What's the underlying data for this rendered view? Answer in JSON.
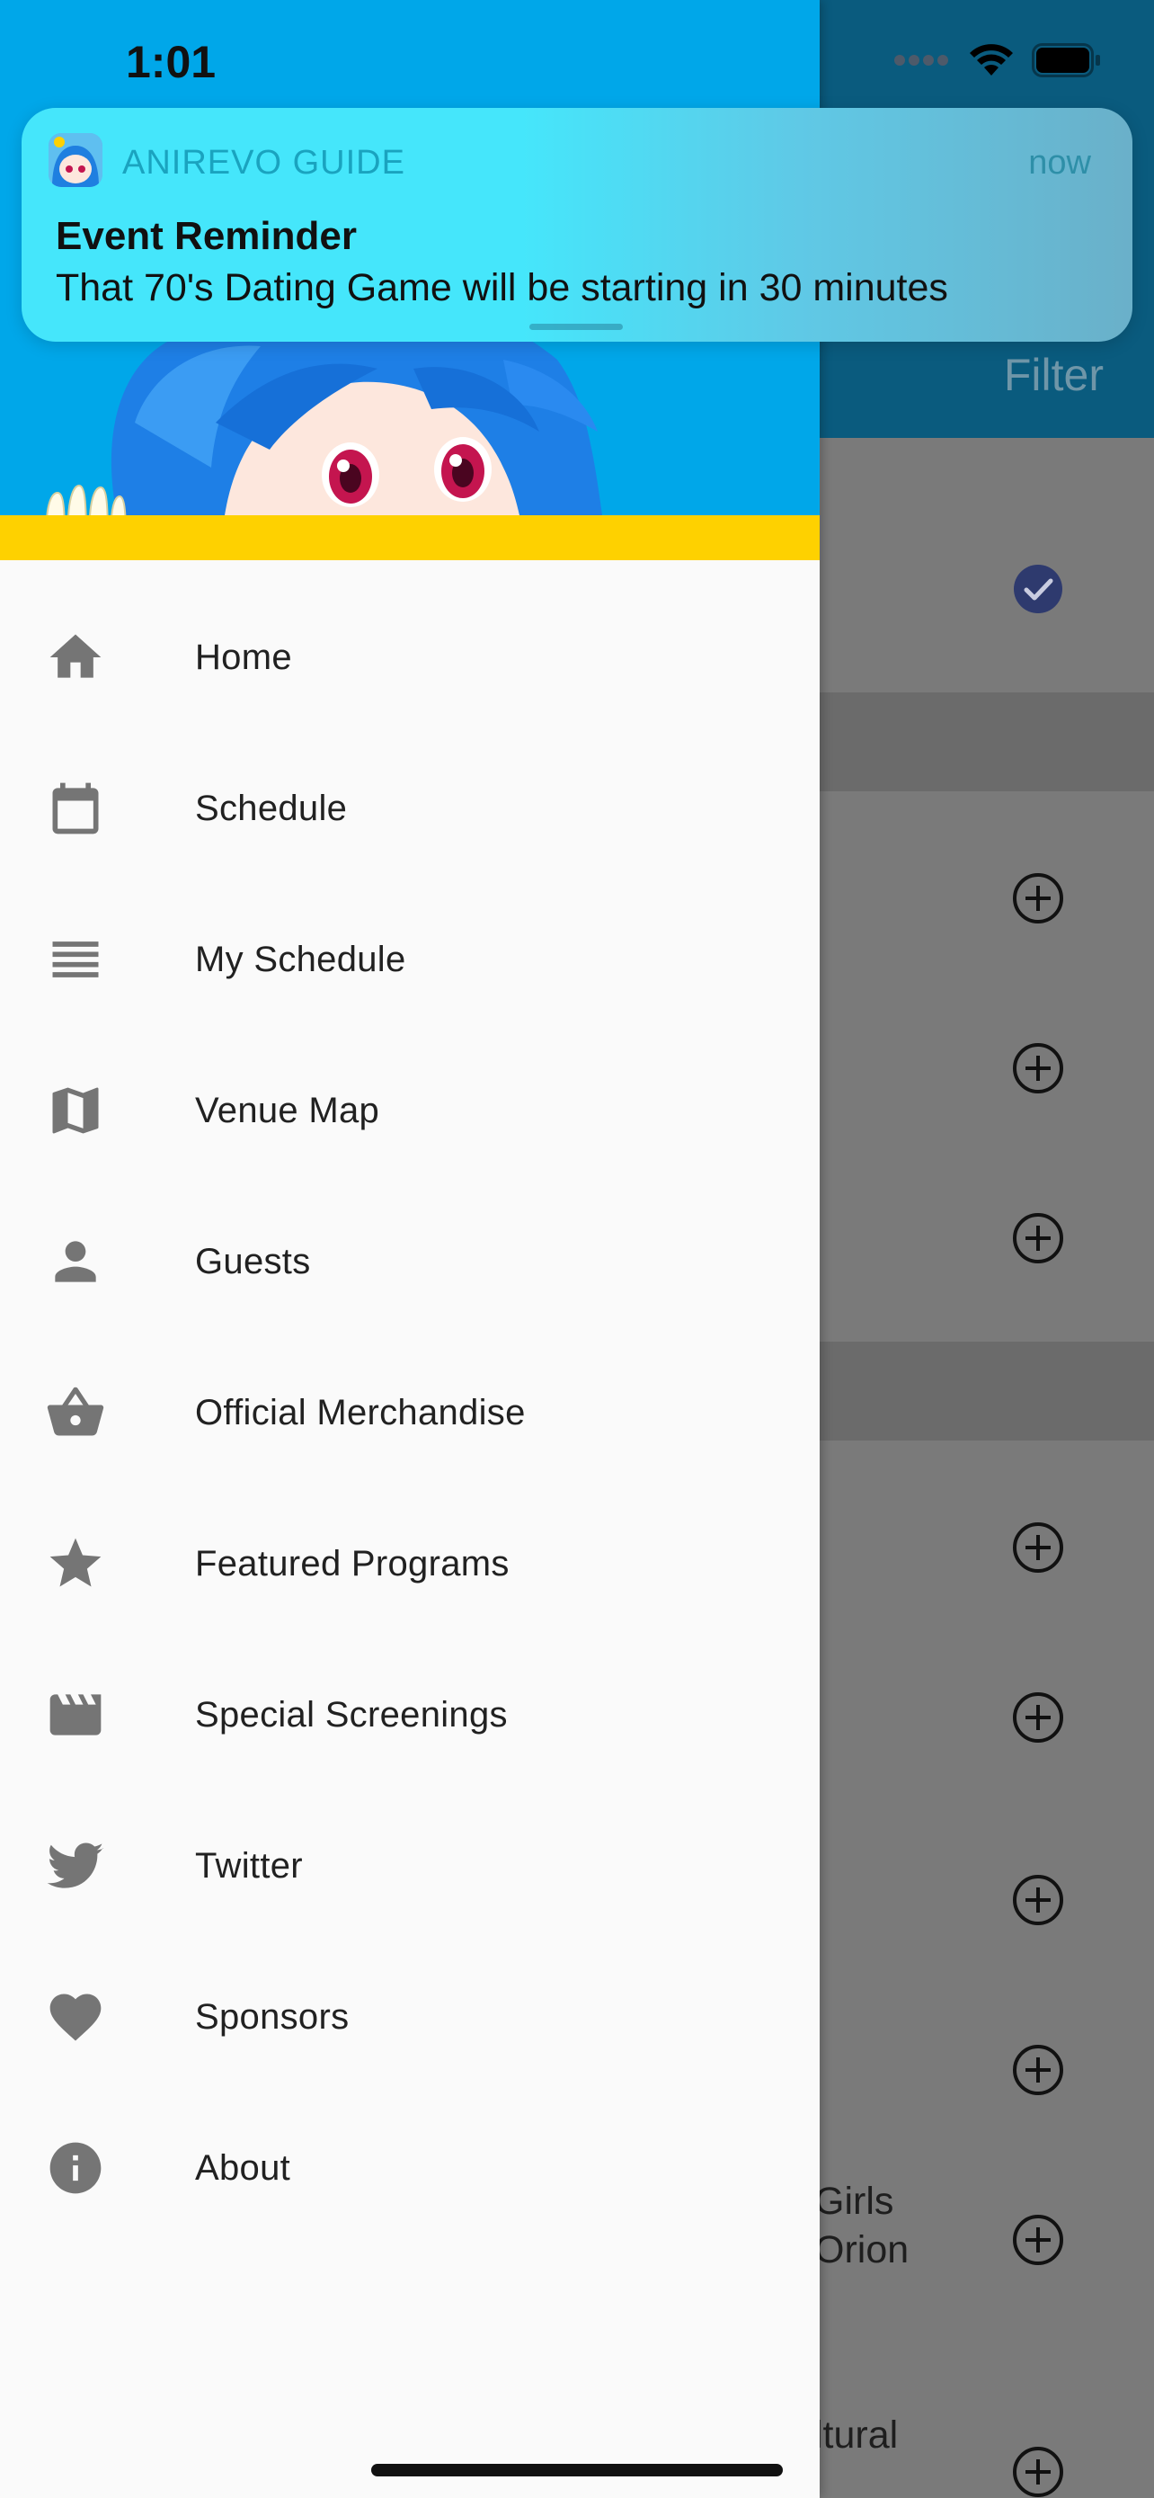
{
  "status_bar": {
    "time": "1:01"
  },
  "notification": {
    "app_name": "ANIREVO GUIDE",
    "time": "now",
    "title": "Event Reminder",
    "body": "That 70's Dating Game will be starting in 30 minutes"
  },
  "background_screen": {
    "filter_label": "Filter",
    "partial_texts": [
      "Girls",
      "Orion",
      "ltural"
    ]
  },
  "drawer": {
    "colors": {
      "header": "#00a7e9",
      "accent_bar": "#fed100",
      "icon": "#757575"
    },
    "items": [
      {
        "label": "Home",
        "icon": "home-icon"
      },
      {
        "label": "Schedule",
        "icon": "calendar-icon"
      },
      {
        "label": "My Schedule",
        "icon": "list-icon"
      },
      {
        "label": "Venue Map",
        "icon": "map-icon"
      },
      {
        "label": "Guests",
        "icon": "person-icon"
      },
      {
        "label": "Official Merchandise",
        "icon": "basket-icon"
      },
      {
        "label": "Featured Programs",
        "icon": "star-icon"
      },
      {
        "label": "Special Screenings",
        "icon": "movie-icon"
      },
      {
        "label": "Twitter",
        "icon": "twitter-icon"
      },
      {
        "label": "Sponsors",
        "icon": "heart-icon"
      },
      {
        "label": "About",
        "icon": "info-icon"
      }
    ]
  }
}
